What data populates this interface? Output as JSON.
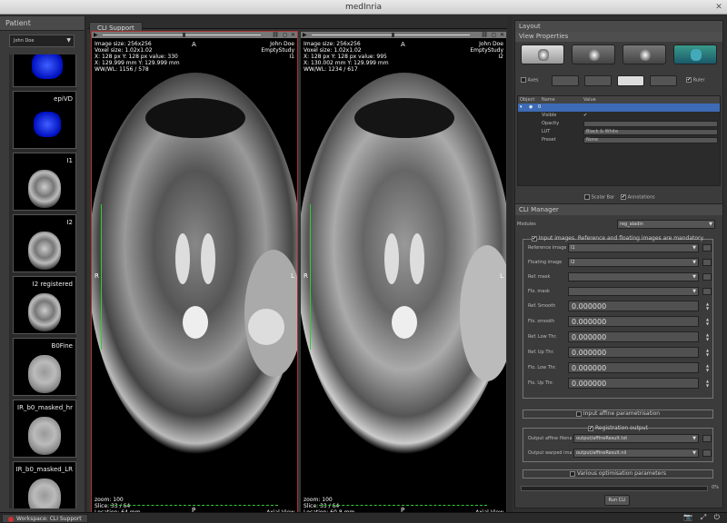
{
  "window": {
    "title": "medInria",
    "close_glyph": "✕"
  },
  "patient": {
    "header": "Patient",
    "selected": "John Doe",
    "series": [
      {
        "label": ""
      },
      {
        "label": "epiVD"
      },
      {
        "label": "I1"
      },
      {
        "label": "I2"
      },
      {
        "label": "I2 registered"
      },
      {
        "label": "B0Fine"
      },
      {
        "label": "IR_b0_masked_hr"
      },
      {
        "label": "IR_b0_masked_LR"
      }
    ]
  },
  "workspace_tab": "CLI Support",
  "views": [
    {
      "info_tl": [
        "Image size: 256x256",
        "Voxel size: 1.02x1.02",
        "X: 128 px Y: 128 px value:  330",
        "X: 129.999 mm Y: 129.999 mm",
        "WW/WL: 1156 / 578"
      ],
      "info_tr": [
        "John Doe",
        "EmptyStudy",
        "I1"
      ],
      "info_bl": [
        "zoom: 100",
        "Slice: 33 / 64",
        "Location: 64 mm"
      ],
      "info_br": "Axial View",
      "top": "A",
      "bottom": "P",
      "left": "R",
      "right": "L"
    },
    {
      "info_tl": [
        "Image size: 256x256",
        "Voxel size: 1.02x1.02",
        "X: 128 px Y: 128 px value:  995",
        "X: 130.002 mm Y: 129.999 mm",
        "WW/WL: 1234 / 617"
      ],
      "info_tr": [
        "John Doe",
        "EmptyStudy",
        "I2"
      ],
      "info_bl": [
        "zoom: 100",
        "Slice: 33 / 64",
        "Location: 60.8 mm"
      ],
      "info_br": "Axial View",
      "top": "A",
      "bottom": "P",
      "left": "R",
      "right": "L"
    }
  ],
  "layout": {
    "header": "Layout",
    "view_props": "View Properties",
    "axes": "Axes",
    "ruler": "Ruler",
    "columns": [
      "Object",
      "Name",
      "Value"
    ],
    "root_value": "0",
    "props": [
      {
        "name": "Visible",
        "value": "✔"
      },
      {
        "name": "Opacity",
        "value": ""
      },
      {
        "name": "LUT",
        "value": "Black & White"
      },
      {
        "name": "Preset",
        "value": "None"
      }
    ],
    "scalar_bar": "Scalar Bar",
    "annotations": "Annotations"
  },
  "cli": {
    "header": "CLI Manager",
    "modules_label": "Modules",
    "module": "reg_aladin",
    "input_group": "Input images. Reference and floating images are mandatory.",
    "reference": {
      "label": "Reference image",
      "value": "I1"
    },
    "floating": {
      "label": "Floating image",
      "value": "I2"
    },
    "ref_mask": "Ref. mask",
    "flo_mask": "Flo. mask",
    "numbers": [
      {
        "label": "Ref. Smooth",
        "value": "0.000000"
      },
      {
        "label": "Flo. smooth",
        "value": "0.000000"
      },
      {
        "label": "Ref. Low Thr.",
        "value": "0.000000"
      },
      {
        "label": "Ref. Up Thr.",
        "value": "0.000000"
      },
      {
        "label": "Flo. Low Thr.",
        "value": "0.000000"
      },
      {
        "label": "Flo. Up Thr.",
        "value": "0.000000"
      }
    ],
    "affine_group": "Input affine parametrisation",
    "output_group": "Registration output",
    "output_affine": {
      "label": "Output affine filename",
      "value": "output/affineResult.txt"
    },
    "output_warped": {
      "label": "Output warped image",
      "value": "output/affineResult.nii"
    },
    "optim_group": "Various optimisation parameters",
    "progress": 0,
    "progress_label": "0%",
    "run": "Run CLI"
  },
  "status": {
    "workspace": "Workspace: CLI Support"
  },
  "colors": {
    "accent": "#3d6bb5",
    "selected_view": "#aa3333",
    "ruler": "#33cc33"
  }
}
